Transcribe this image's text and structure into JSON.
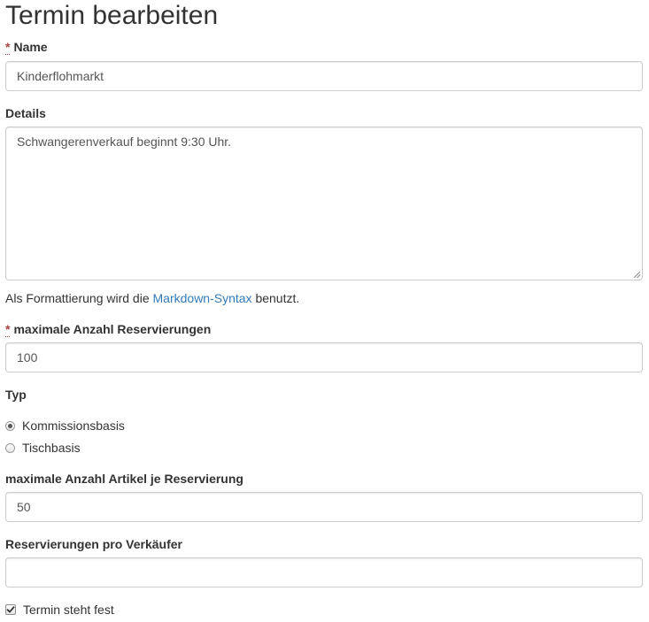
{
  "page": {
    "title": "Termin bearbeiten"
  },
  "form": {
    "required_marker": "*",
    "name": {
      "label": "Name",
      "value": "Kinderflohmarkt"
    },
    "details": {
      "label": "Details",
      "value": "Schwangerenverkauf beginnt 9:30 Uhr.",
      "help_prefix": "Als Formattierung wird die ",
      "help_link": "Markdown-Syntax",
      "help_suffix": " benutzt."
    },
    "max_reservations": {
      "label": "maximale Anzahl Reservierungen",
      "value": "100"
    },
    "type": {
      "label": "Typ",
      "options": [
        {
          "label": "Kommissionsbasis",
          "checked": true
        },
        {
          "label": "Tischbasis",
          "checked": false
        }
      ]
    },
    "max_articles": {
      "label": "maximale Anzahl Artikel je Reservierung",
      "value": "50"
    },
    "reservations_per_seller": {
      "label": "Reservierungen pro Verkäufer",
      "value": ""
    },
    "fixed": {
      "label": "Termin steht fest",
      "checked": true
    }
  },
  "icons": {
    "checkmark": "checkmark-icon",
    "resize_grip": "resize-grip-icon"
  },
  "colors": {
    "text": "#333333",
    "required": "#a94442",
    "link": "#337ab7",
    "border": "#cccccc"
  }
}
